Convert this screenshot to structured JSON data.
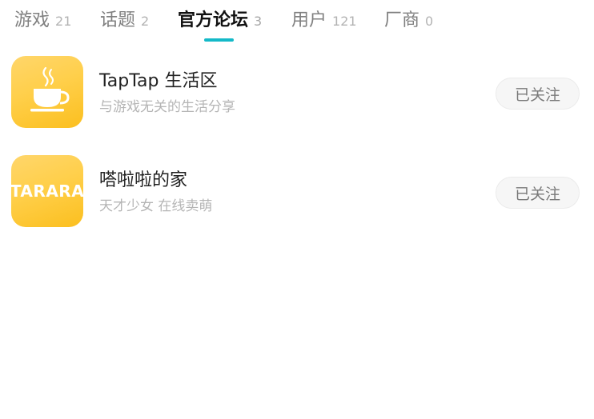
{
  "tabs": [
    {
      "label": "游戏",
      "count": "21"
    },
    {
      "label": "话题",
      "count": "2"
    },
    {
      "label": "官方论坛",
      "count": "3"
    },
    {
      "label": "用户",
      "count": "121"
    },
    {
      "label": "厂商",
      "count": "0"
    }
  ],
  "active_tab": "官方论坛",
  "accent_color": "#14b9c8",
  "forums": [
    {
      "title": "TapTap 生活区",
      "subtitle": "与游戏无关的生活分享",
      "button": "已关注",
      "icon": "coffee-cup-icon"
    },
    {
      "title": "嗒啦啦的家",
      "subtitle": "天才少女 在线卖萌",
      "button": "已关注",
      "logo_text": "TARARA"
    }
  ]
}
